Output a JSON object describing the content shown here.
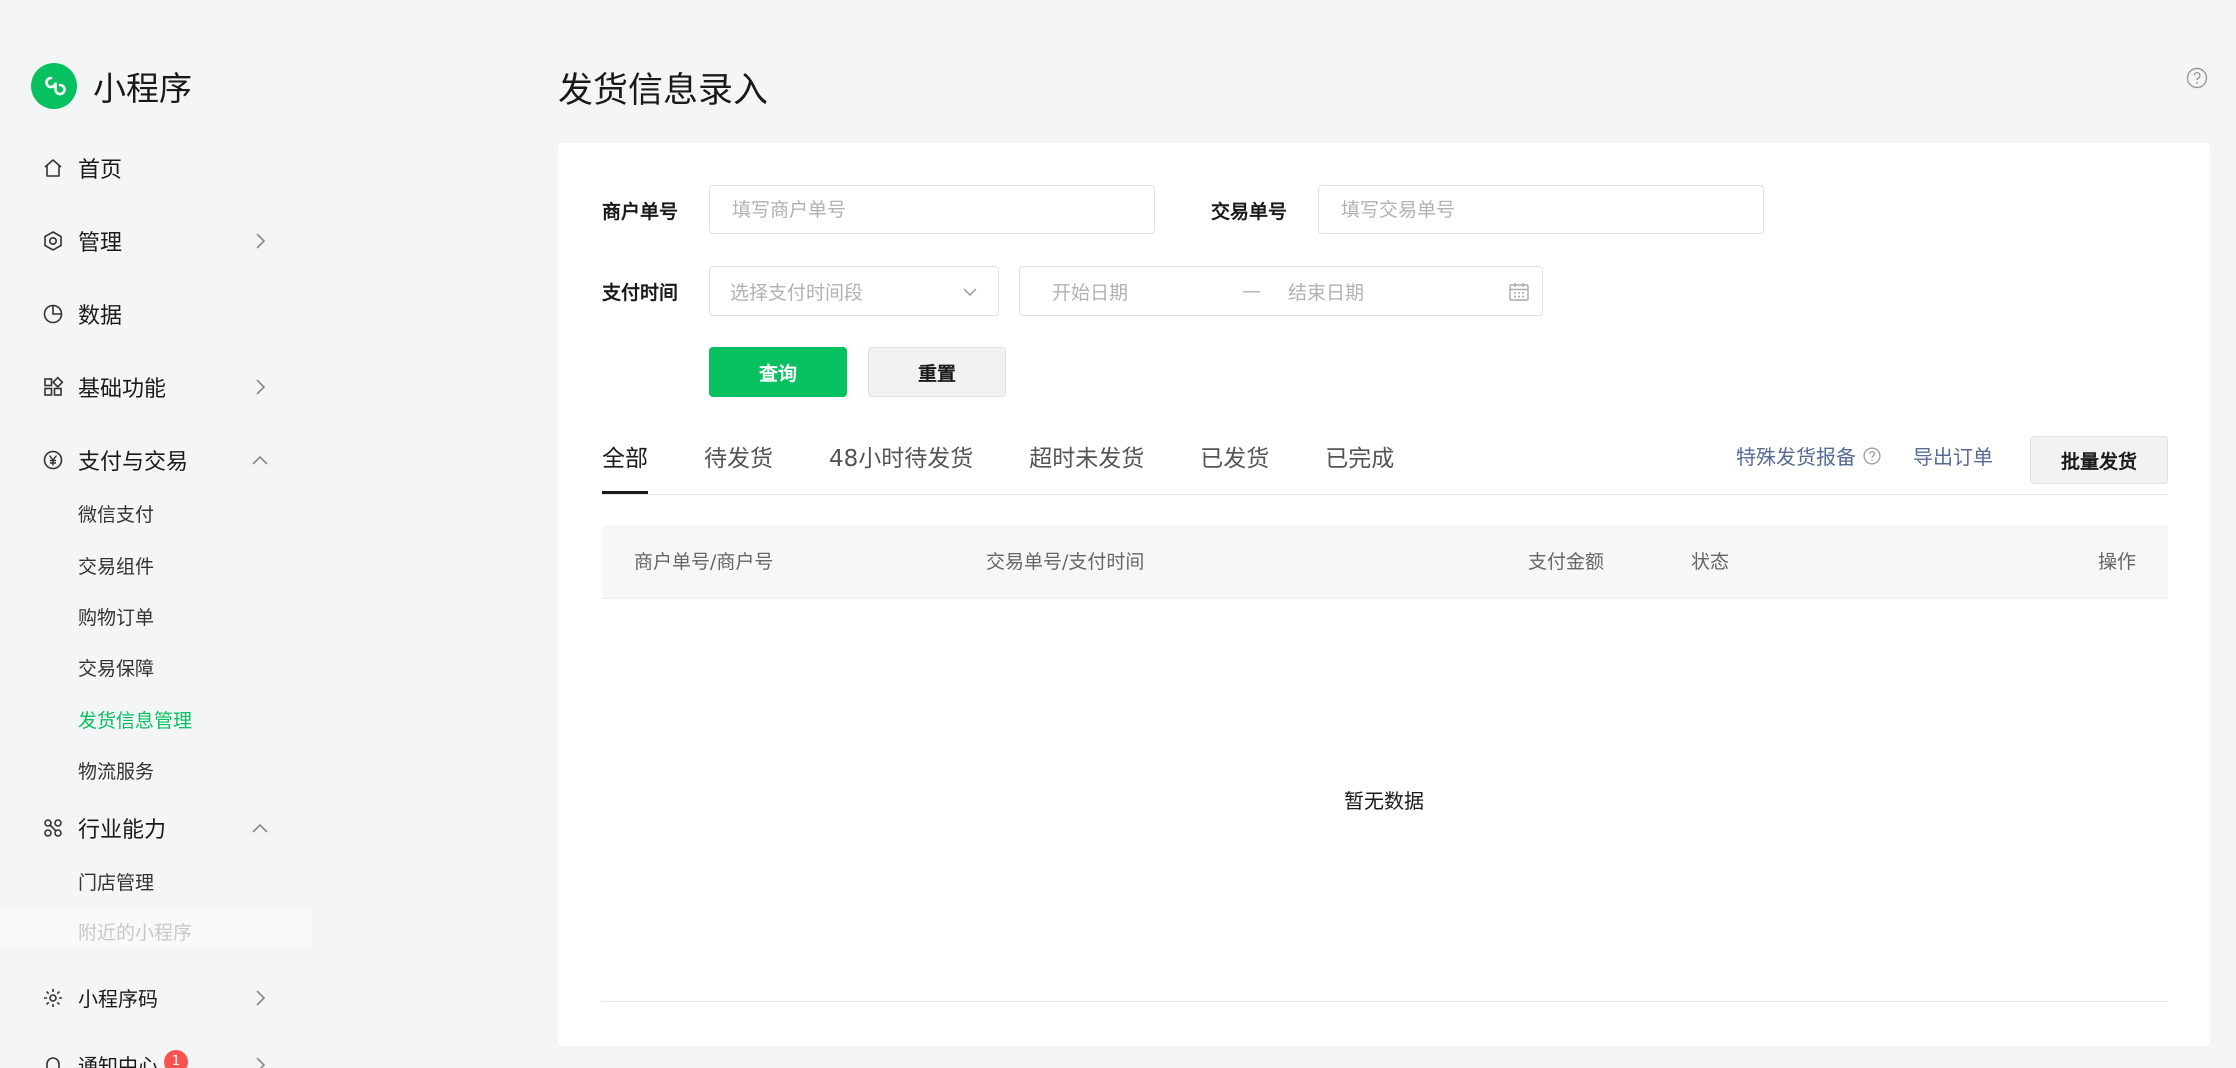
{
  "brand": {
    "name": "小程序"
  },
  "nav": {
    "home": "首页",
    "manage": "管理",
    "data": "数据",
    "basic": "基础功能",
    "payment": "支付与交易",
    "payment_items": [
      "微信支付",
      "交易组件",
      "购物订单",
      "交易保障",
      "发货信息管理",
      "物流服务"
    ],
    "industry": "行业能力",
    "industry_items": [
      "门店管理",
      "附近的小程序"
    ],
    "qrcode": "小程序码",
    "notify": "通知中心",
    "notify_badge": "1"
  },
  "page": {
    "title": "发货信息录入"
  },
  "filters": {
    "merchant_label": "商户单号",
    "merchant_placeholder": "填写商户单号",
    "trade_label": "交易单号",
    "trade_placeholder": "填写交易单号",
    "paytime_label": "支付时间",
    "paytime_placeholder": "选择支付时间段",
    "start_placeholder": "开始日期",
    "range_sep": "—",
    "end_placeholder": "结束日期",
    "query_label": "查询",
    "reset_label": "重置"
  },
  "tabs": [
    "全部",
    "待发货",
    "48小时待发货",
    "超时未发货",
    "已发货",
    "已完成"
  ],
  "actions": {
    "special_report": "特殊发货报备",
    "export": "导出订单",
    "batch_ship": "批量发货"
  },
  "table": {
    "columns": [
      "商户单号/商户号",
      "交易单号/支付时间",
      "支付金额",
      "状态",
      "操作"
    ],
    "empty": "暂无数据"
  },
  "colors": {
    "accent": "#07c160",
    "link": "#576b95",
    "badge": "#fa5151"
  }
}
